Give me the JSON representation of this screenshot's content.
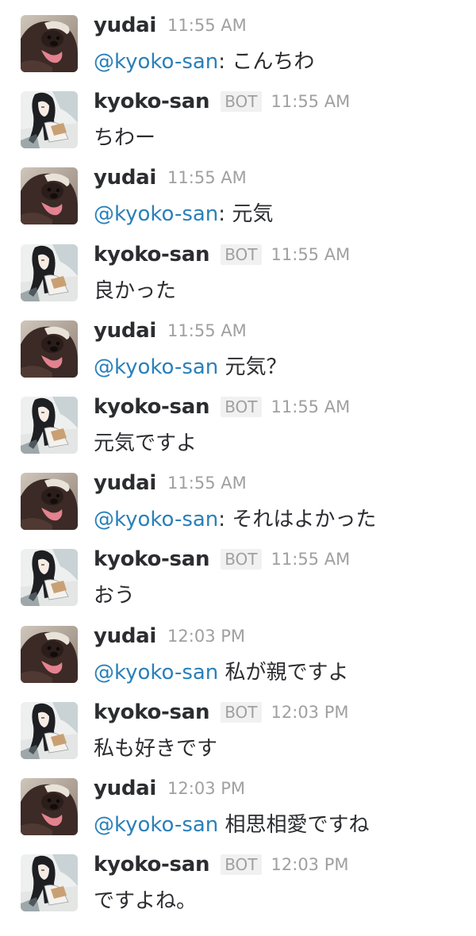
{
  "messages": [
    {
      "user": "yudai",
      "bot": false,
      "time": "11:55 AM",
      "mention": "@kyoko-san",
      "text": ": こんちわ"
    },
    {
      "user": "kyoko-san",
      "bot": true,
      "badge": "BOT",
      "time": "11:55 AM",
      "mention": "",
      "text": "ちわー"
    },
    {
      "user": "yudai",
      "bot": false,
      "time": "11:55 AM",
      "mention": "@kyoko-san",
      "text": ": 元気"
    },
    {
      "user": "kyoko-san",
      "bot": true,
      "badge": "BOT",
      "time": "11:55 AM",
      "mention": "",
      "text": "良かった"
    },
    {
      "user": "yudai",
      "bot": false,
      "time": "11:55 AM",
      "mention": "@kyoko-san",
      "text": " 元気？"
    },
    {
      "user": "kyoko-san",
      "bot": true,
      "badge": "BOT",
      "time": "11:55 AM",
      "mention": "",
      "text": "元気ですよ"
    },
    {
      "user": "yudai",
      "bot": false,
      "time": "11:55 AM",
      "mention": "@kyoko-san",
      "text": ": それはよかった"
    },
    {
      "user": "kyoko-san",
      "bot": true,
      "badge": "BOT",
      "time": "11:55 AM",
      "mention": "",
      "text": "おう"
    },
    {
      "user": "yudai",
      "bot": false,
      "time": "12:03 PM",
      "mention": "@kyoko-san",
      "text": " 私が親ですよ"
    },
    {
      "user": "kyoko-san",
      "bot": true,
      "badge": "BOT",
      "time": "12:03 PM",
      "mention": "",
      "text": "私も好きです"
    },
    {
      "user": "yudai",
      "bot": false,
      "time": "12:03 PM",
      "mention": "@kyoko-san",
      "text": " 相思相愛ですね"
    },
    {
      "user": "kyoko-san",
      "bot": true,
      "badge": "BOT",
      "time": "12:03 PM",
      "mention": "",
      "text": "ですよね。"
    }
  ],
  "colors": {
    "mention": "#2a80b9",
    "username": "#2c2d30",
    "meta": "#a0a0a2",
    "badge_bg": "#f1f1f1"
  },
  "avatars": {
    "yudai": "dog-photo-avatar",
    "kyoko-san": "anime-girl-reading-avatar"
  }
}
